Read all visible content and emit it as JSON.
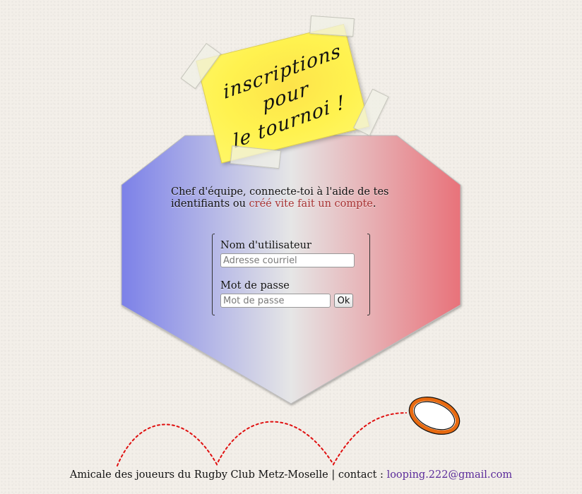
{
  "note": {
    "line1": "inscriptions pour",
    "line2": "le tournoi !"
  },
  "intro": {
    "text_before": "Chef d'équipe, connecte-toi à l'aide de tes identifiants ou ",
    "link": "créé vite fait un compte",
    "text_after": "."
  },
  "form": {
    "username_label": "Nom d'utilisateur",
    "username_placeholder": "Adresse courriel",
    "username_value": "",
    "password_label": "Mot de passe",
    "password_placeholder": "Mot de passe",
    "password_value": "",
    "submit_label": "Ok"
  },
  "footer": {
    "text": "Amicale des joueurs du Rugby Club Metz-Moselle | contact : ",
    "email": "looping.222@gmail.com"
  },
  "colors": {
    "flag_blue": "#7f84e6",
    "flag_white": "#e8e8e8",
    "flag_red": "#e8767a",
    "link_red": "#a83434",
    "email_purple": "#5a2a9a",
    "ball_orange": "#e86a10",
    "trajectory_red": "#e01010",
    "note_yellow": "#fff24f"
  },
  "icons": {
    "ball": "rugby-ball-icon"
  }
}
